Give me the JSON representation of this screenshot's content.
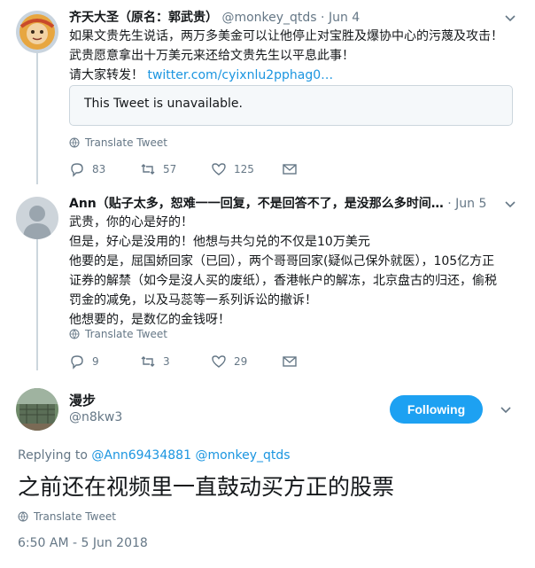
{
  "tweet1": {
    "name": "齐天大圣（原名：郭武贵）",
    "handle": "@monkey_qtds",
    "date": "Jun 4",
    "lines": [
      "如果文贵先生说话，两万多美金可以让他停止对宝胜及爆协中心的污蔑及攻击！",
      "武贵愿意拿出十万美元来还给文贵先生以平息此事！"
    ],
    "line3_prefix": "请大家转发！",
    "link": "twitter.com/cyixnlu2pphag0…",
    "quote_text": "This Tweet is unavailable.",
    "translate": "Translate Tweet",
    "replies": "83",
    "retweets": "57",
    "likes": "125"
  },
  "tweet2": {
    "name": "Ann（贴子太多，恕难一一回复，不是回答不了，是没那么多时间…",
    "date": "Jun 5",
    "lines": [
      "武贵，你的心是好的！",
      "但是，好心是没用的！他想与共匀兑的不仅是10万美元",
      "他要的是，屈国娇回家（已回），两个哥哥回家(疑似己保外就医），105亿方正",
      "证券的解禁（如今是沒人买的废纸），香港帐户的解冻，北京盘古的归还，偷税",
      "罚金的减免，以及马蕊等一系列诉讼的撤诉！",
      "他想要的，是数亿的金钱呀！"
    ],
    "translate": "Translate Tweet",
    "replies": "9",
    "retweets": "3",
    "likes": "29"
  },
  "main": {
    "name": "漫步",
    "handle": "@n8kw3",
    "follow_label": "Following",
    "replying_prefix": "Replying to",
    "reply_to_1": "@Ann69434881",
    "reply_to_2": "@monkey_qtds",
    "text": "之前还在视频里一直鼓动买方正的股票",
    "translate": "Translate Tweet",
    "timestamp": "6:50 AM - 5 Jun 2018"
  },
  "colors": {
    "accent": "#1da1f2",
    "link": "#1b95e0",
    "muted": "#657786",
    "border": "#ccd6dd"
  },
  "icons": [
    "caret-down-icon",
    "globe-icon",
    "reply-icon",
    "retweet-icon",
    "like-icon",
    "message-icon"
  ]
}
